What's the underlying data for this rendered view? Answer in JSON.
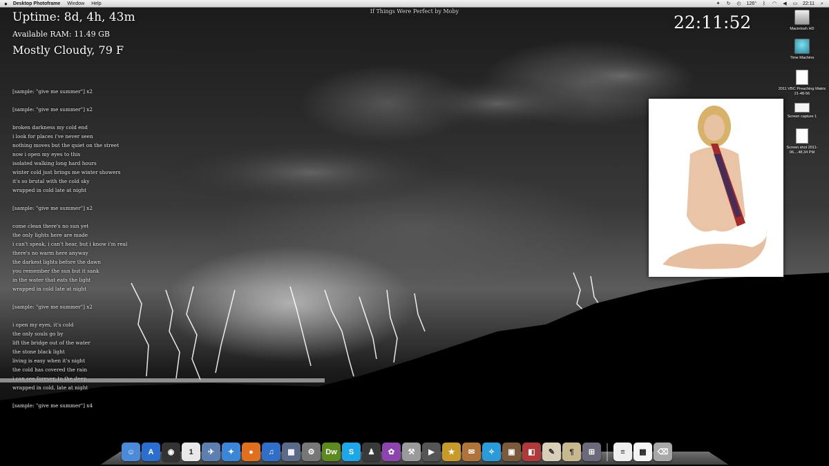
{
  "menubar": {
    "app_name": "Desktop Photoframe",
    "menus": [
      "Window",
      "Help"
    ],
    "temperature": "126°",
    "time": "22:11"
  },
  "widgets": {
    "uptime": "Uptime: 8d, 4h, 43m",
    "ram": "Available RAM: 11.49 GB",
    "weather": "Mostly Cloudy, 79 F",
    "clock": "22:11:52",
    "now_playing": "If Things Were Perfect by Moby"
  },
  "lyrics": [
    "[sample: \"give me summer\"] x2",
    "",
    "[sample: \"give me summer\"] x2",
    "",
    "broken darkness my cold end",
    "i look for places i've never seen",
    "nothing moves but the quiet on the street",
    "now i open my eyes to this",
    "isolated walking long hard hours",
    "winter cold just brings me winter showers",
    "it's so brutal with the cold sky",
    "wrapped in cold late at night",
    "",
    "[sample: \"give me summer\"] x2",
    "",
    "come clean there's no sun yet",
    "the only lights here are made",
    "i can't speak, i can't hear, but i know i'm real",
    "there's no warm here anyway",
    "the darkest lights before the dawn",
    "you remember the sun but it sank",
    "in the water that eats the light",
    "wrapped in cold late at night",
    "",
    "[sample: \"give me summer\"] x2",
    "",
    "i open my eyes, it's cold",
    "the only souls go by",
    "lift the bridge out of the water",
    "the stone black light",
    "living is easy when it's night",
    "the cold has covered the rain",
    "i can see forever, to the deep",
    "wrapped in cold, late at night",
    "",
    "[sample: \"give me summer\"] x4"
  ],
  "desktop_icons": [
    {
      "label": "Macintosh HD",
      "kind": "hd"
    },
    {
      "label": "Time Machine",
      "kind": "tm"
    },
    {
      "label": "2011 VBC Preaching Matrix 21-48-56",
      "kind": "doc"
    },
    {
      "label": "Screen capture 1",
      "kind": "cap"
    },
    {
      "label": "Screen shot 2011-06....48.34 PM",
      "kind": "shot"
    }
  ],
  "dock": [
    {
      "name": "finder-icon",
      "glyph": "☺",
      "color": "#4a8ad8"
    },
    {
      "name": "app-store-icon",
      "glyph": "A",
      "color": "#2a6fd0"
    },
    {
      "name": "dashboard-icon",
      "glyph": "◉",
      "color": "#333333"
    },
    {
      "name": "ical-icon",
      "glyph": "1",
      "color": "#e8e8e8"
    },
    {
      "name": "preview-icon",
      "glyph": "✈",
      "color": "#5d7fb0"
    },
    {
      "name": "safari-icon",
      "glyph": "✦",
      "color": "#3a86d8"
    },
    {
      "name": "firefox-icon",
      "glyph": "●",
      "color": "#e0701e"
    },
    {
      "name": "itunes-icon",
      "glyph": "♫",
      "color": "#2f6fc8"
    },
    {
      "name": "mission-control-icon",
      "glyph": "▦",
      "color": "#5a6a88"
    },
    {
      "name": "system-preferences-icon",
      "glyph": "⚙",
      "color": "#777777"
    },
    {
      "name": "dreamweaver-icon",
      "glyph": "Dw",
      "color": "#5c8a1e"
    },
    {
      "name": "skype-icon",
      "glyph": "S",
      "color": "#1ea7e8"
    },
    {
      "name": "alfred-icon",
      "glyph": "♟",
      "color": "#3a3a3a"
    },
    {
      "name": "growl-icon",
      "glyph": "✿",
      "color": "#8e44ad"
    },
    {
      "name": "automator-icon",
      "glyph": "⚒",
      "color": "#9a9a9a"
    },
    {
      "name": "facetime-icon",
      "glyph": "▶",
      "color": "#555555"
    },
    {
      "name": "imovie-icon",
      "glyph": "★",
      "color": "#c89a2a"
    },
    {
      "name": "sparrow-icon",
      "glyph": "✉",
      "color": "#b0743a"
    },
    {
      "name": "twitter-icon",
      "glyph": "✧",
      "color": "#2a9ad8"
    },
    {
      "name": "iphoto-icon",
      "glyph": "▣",
      "color": "#7a5a3a"
    },
    {
      "name": "photo-booth-icon",
      "glyph": "◧",
      "color": "#b03a3a"
    },
    {
      "name": "text-edit-icon",
      "glyph": "✎",
      "color": "#d8cfb8"
    },
    {
      "name": "script-editor-icon",
      "glyph": "¶",
      "color": "#c8b890"
    },
    {
      "name": "image-capture-icon",
      "glyph": "⊞",
      "color": "#6a6a7a"
    },
    {
      "name": "document-icon",
      "glyph": "≡",
      "color": "#eeeeee"
    },
    {
      "name": "qr-code-icon",
      "glyph": "▩",
      "color": "#f4f4f4"
    },
    {
      "name": "trash-icon",
      "glyph": "⌫",
      "color": "#a8a8a8"
    }
  ]
}
